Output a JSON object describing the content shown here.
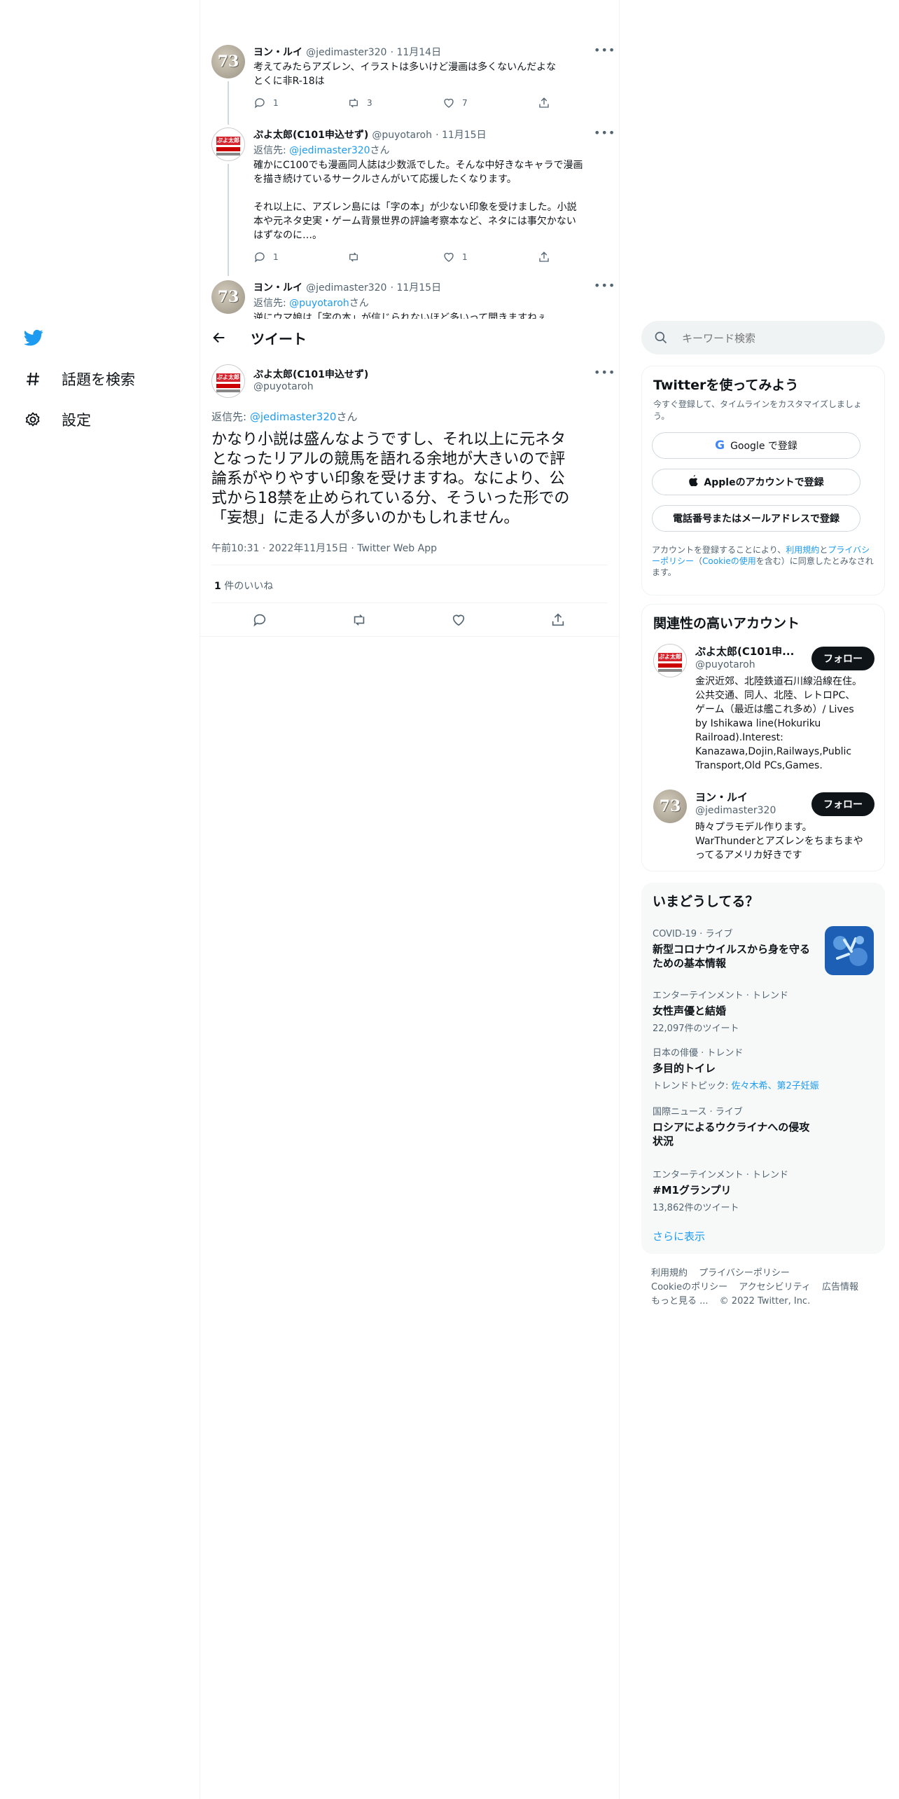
{
  "nav": {
    "items": [
      {
        "label": "話題を検索"
      },
      {
        "label": "設定"
      }
    ]
  },
  "thread": [
    {
      "name": "ヨン・ルイ",
      "handle": "@jedimaster320",
      "date": "· 11月14日",
      "text_lines": [
        "考えてみたらアズレン、イラストは多いけど漫画は多くないんだよな",
        "とくに非R-18は"
      ],
      "counts": {
        "reply": "1",
        "retweet": "3",
        "like": "7"
      }
    },
    {
      "name": "ぷよ太郎(C101申込せず)",
      "handle": "@puyotaroh",
      "date": "· 11月15日",
      "reply_prefix": "返信先: ",
      "reply_to": "@jedimaster320",
      "reply_suffix": "さん",
      "text_lines": [
        "確かにC100でも漫画同人誌は少数派でした。そんな中好きなキャラで漫画",
        "を描き続けているサークルさんがいて応援したくなります。",
        "",
        "それ以上に、アズレン島には「字の本」が少ない印象を受けました。小説",
        "本や元ネタ史実・ゲーム背景世界の評論考察本など、ネタには事欠かない",
        "はずなのに…。"
      ],
      "counts": {
        "reply": "1",
        "retweet": "",
        "like": "1"
      }
    },
    {
      "name": "ヨン・ルイ",
      "handle": "@jedimaster320",
      "date": "· 11月15日",
      "reply_prefix": "返信先: ",
      "reply_to": "@puyotaroh",
      "reply_suffix": "さん",
      "text_lines": [
        "逆にウマ娘は「字の本」が信じられないほど多いって聞きますねぇ"
      ]
    }
  ],
  "header": {
    "title": "ツイート"
  },
  "main_tweet": {
    "name": "ぷよ太郎(C101申込せず)",
    "handle": "@puyotaroh",
    "reply_prefix": "返信先: ",
    "reply_to": "@jedimaster320",
    "reply_suffix": "さん",
    "text_lines": [
      "かなり小説は盛んなようですし、それ以上に元ネタ",
      "となったリアルの競馬を語れる余地が大きいので評",
      "論系がやりやすい印象を受けますね。なにより、公",
      "式から18禁を止められている分、そういった形での",
      "「妄想」に走る人が多いのかもしれません。"
    ],
    "time": "午前10:31 · 2022年11月15日 · Twitter Web App",
    "likes_count": "1",
    "likes_label": "件のいいね"
  },
  "search": {
    "placeholder": "キーワード検索"
  },
  "signup": {
    "title": "Twitterを使ってみよう",
    "subtitle": "今すぐ登録して、タイムラインをカスタマイズしましょう。",
    "google": "Google で登録",
    "apple": "Appleのアカウントで登録",
    "phone": "電話番号またはメールアドレスで登録",
    "terms_1": "アカウントを登録することにより、",
    "terms_link1": "利用規約",
    "terms_2": "と",
    "terms_link2": "プライバシーポリシー",
    "terms_3": "（",
    "terms_link3": "Cookieの使用",
    "terms_4": "を含む）に同意したとみなされます。"
  },
  "related": {
    "title": "関連性の高いアカウント",
    "accounts": [
      {
        "name": "ぷよ太郎(C101申...",
        "handle": "@puyotaroh",
        "follow": "フォロー",
        "bio_lines": [
          "金沢近郊、北陸鉄道石川線沿線在住。",
          "公共交通、同人、北陸、レトロPC、",
          "ゲーム（最近は艦これ多め）/ Lives",
          "by Ishikawa line(Hokuriku",
          "Railroad).Interest:",
          "Kanazawa,Dojin,Railways,Public",
          "Transport,Old PCs,Games."
        ]
      },
      {
        "name": "ヨン・ルイ",
        "handle": "@jedimaster320",
        "follow": "フォロー",
        "bio_lines": [
          "時々プラモデル作ります。",
          "WarThunderとアズレンをちまちまや",
          "ってるアメリカ好きです"
        ]
      }
    ]
  },
  "trends": {
    "title": "いまどうしてる？",
    "items": [
      {
        "category": "COVID-19 · ライブ",
        "title_lines": [
          "新型コロナウイルスから身を守る",
          "ための基本情報"
        ]
      },
      {
        "category": "エンターテインメント · トレンド",
        "title_lines": [
          "女性声優と結婚"
        ],
        "sub": "22,097件のツイート"
      },
      {
        "category": "日本の俳優 · トレンド",
        "title_lines": [
          "多目的トイレ"
        ],
        "sub_prefix": "トレンドトピック: ",
        "sub_link": "佐々木希、第2子妊娠"
      },
      {
        "category": "国際ニュース · ライブ",
        "title_lines": [
          "ロシアによるウクライナへの侵攻",
          "状況"
        ]
      },
      {
        "category": "エンターテインメント · トレンド",
        "title_lines": [
          "#M1グランプリ"
        ],
        "sub": "13,862件のツイート"
      }
    ],
    "show_more": "さらに表示"
  },
  "footer": {
    "links_row1": [
      "利用規約",
      "プライバシーポリシー"
    ],
    "links_row2": [
      "Cookieのポリシー",
      "アクセシビリティ",
      "広告情報"
    ],
    "more": "もっと見る ...",
    "copyright": "© 2022 Twitter, Inc."
  },
  "colors": {
    "accent": "#1d9bf0",
    "text": "#0f1419",
    "secondary": "#536471",
    "border": "#eff3f4"
  }
}
